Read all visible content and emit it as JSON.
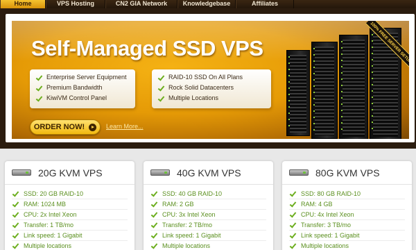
{
  "nav": {
    "items": [
      {
        "label": "Home",
        "active": true
      },
      {
        "label": "VPS Hosting",
        "active": false
      },
      {
        "label": "CN2 GIA Network",
        "active": false
      },
      {
        "label": "Knowledgebase",
        "active": false
      },
      {
        "label": "Affiliates",
        "active": false
      }
    ]
  },
  "hero": {
    "title": "Self-Managed SSD VPS",
    "features_left": [
      "Enterprise Server Equipment",
      "Premium Bandwidth",
      "KiwiVM Control Panel"
    ],
    "features_right": [
      "RAID-10 SSD On All Plans",
      "Rock Solid Datacenters",
      "Multiple Locations"
    ],
    "order_label": "ORDER NOW!",
    "learn_more_label": "Learn More...",
    "ribbon_text": "100% FREE SERVER SETUP",
    "accent_color": "#f2a80c"
  },
  "plans": [
    {
      "title": "20G KVM VPS",
      "specs": [
        "SSD: 20 GB RAID-10",
        "RAM: 1024 MB",
        "CPU: 2x Intel Xeon",
        "Transfer: 1 TB/mo",
        "Link speed: 1 Gigabit",
        "Multiple locations"
      ]
    },
    {
      "title": "40G KVM VPS",
      "specs": [
        "SSD: 40 GB RAID-10",
        "RAM: 2 GB",
        "CPU: 3x Intel Xeon",
        "Transfer: 2 TB/mo",
        "Link speed: 1 Gigabit",
        "Multiple locations"
      ]
    },
    {
      "title": "80G KVM VPS",
      "specs": [
        "SSD: 80 GB RAID-10",
        "RAM: 4 GB",
        "CPU: 4x Intel Xeon",
        "Transfer: 3 TB/mo",
        "Link speed: 1 Gigabit",
        "Multiple locations"
      ]
    }
  ]
}
